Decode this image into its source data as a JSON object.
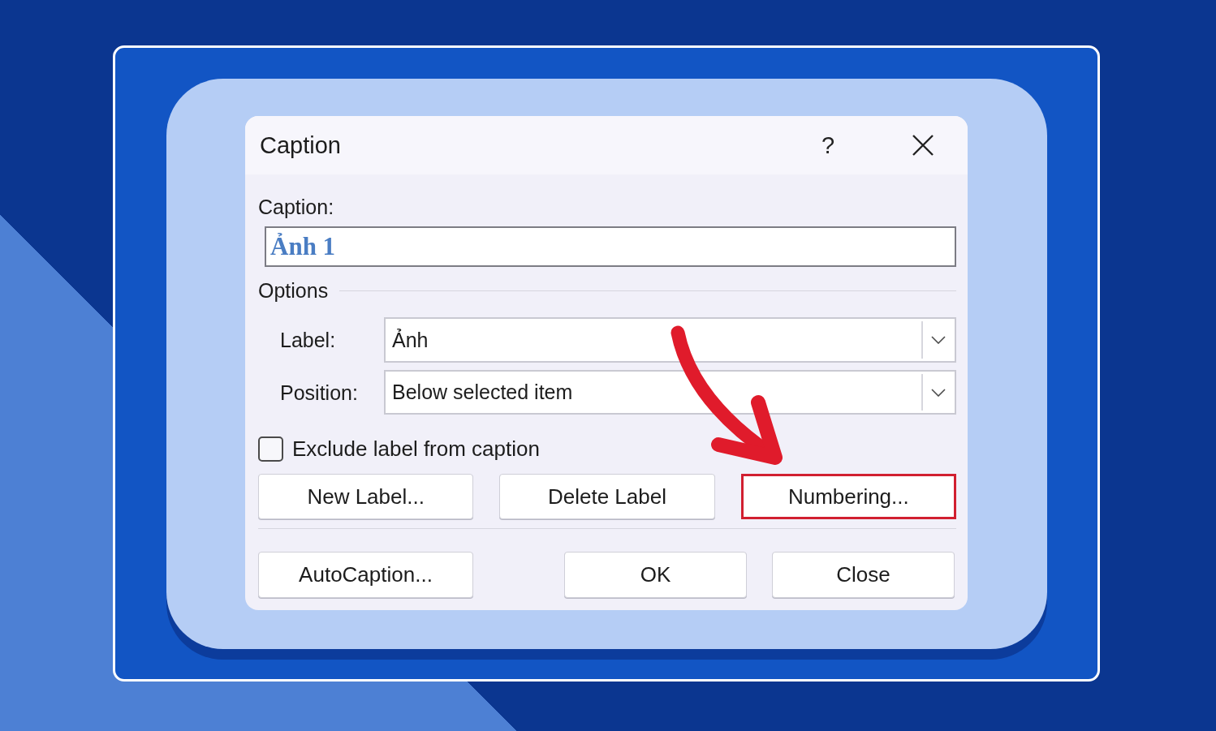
{
  "dialog": {
    "title": "Caption",
    "help_button": "?",
    "caption_field": {
      "label": "Caption:",
      "value": "Ảnh 1"
    },
    "options_group": {
      "title": "Options"
    },
    "dropdowns": [
      {
        "label": "Label:",
        "value": "Ảnh"
      },
      {
        "label": "Position:",
        "value": "Below selected item"
      }
    ],
    "exclude_checkbox": {
      "label": "Exclude label from caption",
      "checked": false
    },
    "label_buttons": [
      {
        "label": "New Label...",
        "highlighted": false
      },
      {
        "label": "Delete Label",
        "highlighted": false
      },
      {
        "label": "Numbering...",
        "highlighted": true
      }
    ],
    "footer_buttons": [
      {
        "kind": "wide",
        "label": "AutoCaption..."
      },
      {
        "kind": "action",
        "label": "OK"
      },
      {
        "kind": "action",
        "label": "Close"
      }
    ]
  }
}
